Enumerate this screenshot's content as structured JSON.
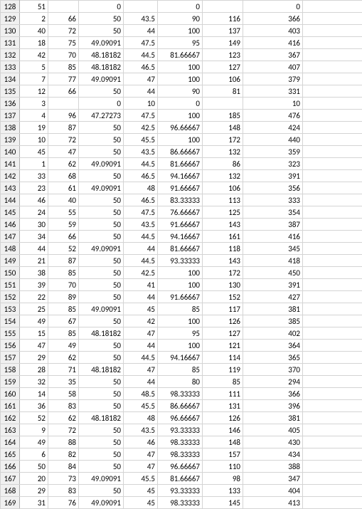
{
  "rows": [
    {
      "h": "128",
      "c": [
        "51",
        "",
        "0",
        "",
        "0",
        "",
        "0",
        ""
      ]
    },
    {
      "h": "129",
      "c": [
        "2",
        "66",
        "50",
        "43.5",
        "90",
        "116",
        "366",
        ""
      ]
    },
    {
      "h": "130",
      "c": [
        "40",
        "72",
        "50",
        "44",
        "100",
        "137",
        "403",
        ""
      ]
    },
    {
      "h": "131",
      "c": [
        "18",
        "75",
        "49.09091",
        "47.5",
        "95",
        "149",
        "416",
        ""
      ]
    },
    {
      "h": "132",
      "c": [
        "42",
        "70",
        "48.18182",
        "44.5",
        "81.66667",
        "123",
        "367",
        ""
      ]
    },
    {
      "h": "133",
      "c": [
        "5",
        "85",
        "48.18182",
        "46.5",
        "100",
        "127",
        "407",
        ""
      ]
    },
    {
      "h": "134",
      "c": [
        "7",
        "77",
        "49.09091",
        "47",
        "100",
        "106",
        "379",
        ""
      ]
    },
    {
      "h": "135",
      "c": [
        "12",
        "66",
        "50",
        "44",
        "90",
        "81",
        "331",
        ""
      ]
    },
    {
      "h": "136",
      "c": [
        "3",
        "",
        "0",
        "10",
        "0",
        "",
        "10",
        ""
      ]
    },
    {
      "h": "137",
      "c": [
        "4",
        "96",
        "47.27273",
        "47.5",
        "100",
        "185",
        "476",
        ""
      ]
    },
    {
      "h": "138",
      "c": [
        "19",
        "87",
        "50",
        "42.5",
        "96.66667",
        "148",
        "424",
        ""
      ]
    },
    {
      "h": "139",
      "c": [
        "10",
        "72",
        "50",
        "45.5",
        "100",
        "172",
        "440",
        ""
      ]
    },
    {
      "h": "140",
      "c": [
        "45",
        "47",
        "50",
        "43.5",
        "86.66667",
        "132",
        "359",
        ""
      ]
    },
    {
      "h": "141",
      "c": [
        "1",
        "62",
        "49.09091",
        "44.5",
        "81.66667",
        "86",
        "323",
        ""
      ]
    },
    {
      "h": "142",
      "c": [
        "33",
        "68",
        "50",
        "46.5",
        "94.16667",
        "132",
        "391",
        ""
      ]
    },
    {
      "h": "143",
      "c": [
        "23",
        "61",
        "49.09091",
        "48",
        "91.66667",
        "106",
        "356",
        ""
      ]
    },
    {
      "h": "144",
      "c": [
        "46",
        "40",
        "50",
        "46.5",
        "83.33333",
        "113",
        "333",
        ""
      ]
    },
    {
      "h": "145",
      "c": [
        "24",
        "55",
        "50",
        "47.5",
        "76.66667",
        "125",
        "354",
        ""
      ]
    },
    {
      "h": "146",
      "c": [
        "30",
        "59",
        "50",
        "43.5",
        "91.66667",
        "143",
        "387",
        ""
      ]
    },
    {
      "h": "147",
      "c": [
        "34",
        "66",
        "50",
        "44.5",
        "94.16667",
        "161",
        "416",
        ""
      ]
    },
    {
      "h": "148",
      "c": [
        "44",
        "52",
        "49.09091",
        "44",
        "81.66667",
        "118",
        "345",
        ""
      ]
    },
    {
      "h": "149",
      "c": [
        "21",
        "87",
        "50",
        "44.5",
        "93.33333",
        "143",
        "418",
        ""
      ]
    },
    {
      "h": "150",
      "c": [
        "38",
        "85",
        "50",
        "42.5",
        "100",
        "172",
        "450",
        ""
      ]
    },
    {
      "h": "151",
      "c": [
        "39",
        "70",
        "50",
        "41",
        "100",
        "130",
        "391",
        ""
      ]
    },
    {
      "h": "152",
      "c": [
        "22",
        "89",
        "50",
        "44",
        "91.66667",
        "152",
        "427",
        ""
      ]
    },
    {
      "h": "153",
      "c": [
        "25",
        "85",
        "49.09091",
        "45",
        "85",
        "117",
        "381",
        ""
      ]
    },
    {
      "h": "154",
      "c": [
        "49",
        "67",
        "50",
        "42",
        "100",
        "126",
        "385",
        ""
      ]
    },
    {
      "h": "155",
      "c": [
        "15",
        "85",
        "48.18182",
        "47",
        "95",
        "127",
        "402",
        ""
      ]
    },
    {
      "h": "156",
      "c": [
        "47",
        "49",
        "50",
        "44",
        "100",
        "121",
        "364",
        ""
      ]
    },
    {
      "h": "157",
      "c": [
        "29",
        "62",
        "50",
        "44.5",
        "94.16667",
        "114",
        "365",
        ""
      ]
    },
    {
      "h": "158",
      "c": [
        "28",
        "71",
        "48.18182",
        "47",
        "85",
        "119",
        "370",
        ""
      ]
    },
    {
      "h": "159",
      "c": [
        "32",
        "35",
        "50",
        "44",
        "80",
        "85",
        "294",
        ""
      ]
    },
    {
      "h": "160",
      "c": [
        "14",
        "58",
        "50",
        "48.5",
        "98.33333",
        "111",
        "366",
        ""
      ]
    },
    {
      "h": "161",
      "c": [
        "36",
        "83",
        "50",
        "45.5",
        "86.66667",
        "131",
        "396",
        ""
      ]
    },
    {
      "h": "162",
      "c": [
        "52",
        "62",
        "48.18182",
        "48",
        "96.66667",
        "126",
        "381",
        ""
      ]
    },
    {
      "h": "163",
      "c": [
        "9",
        "72",
        "50",
        "43.5",
        "93.33333",
        "146",
        "405",
        ""
      ]
    },
    {
      "h": "164",
      "c": [
        "49",
        "88",
        "50",
        "46",
        "98.33333",
        "148",
        "430",
        ""
      ]
    },
    {
      "h": "165",
      "c": [
        "6",
        "82",
        "50",
        "47",
        "98.33333",
        "157",
        "434",
        ""
      ]
    },
    {
      "h": "166",
      "c": [
        "50",
        "84",
        "50",
        "47",
        "96.66667",
        "110",
        "388",
        ""
      ]
    },
    {
      "h": "167",
      "c": [
        "20",
        "73",
        "49.09091",
        "45.5",
        "81.66667",
        "98",
        "347",
        ""
      ]
    },
    {
      "h": "168",
      "c": [
        "29",
        "83",
        "50",
        "45",
        "93.33333",
        "133",
        "404",
        ""
      ]
    },
    {
      "h": "169",
      "c": [
        "31",
        "76",
        "49.09091",
        "45",
        "98.33333",
        "145",
        "413",
        ""
      ]
    }
  ]
}
